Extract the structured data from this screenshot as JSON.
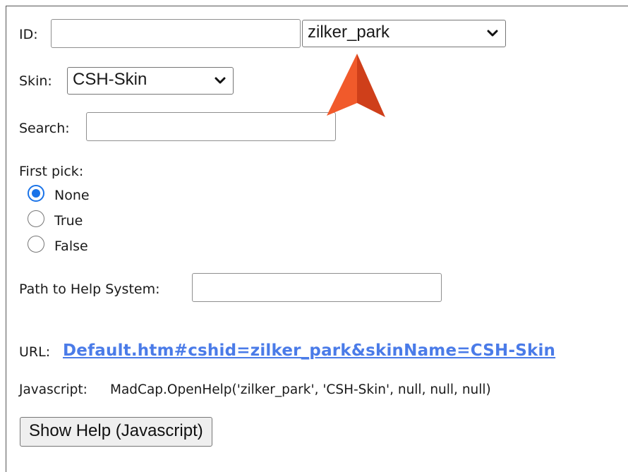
{
  "form": {
    "id_label": "ID:",
    "id_value": "",
    "id_select_value": "zilker_park",
    "skin_label": "Skin:",
    "skin_select_value": "CSH-Skin",
    "search_label": "Search:",
    "search_value": "",
    "first_pick_label": "First pick:",
    "radio_options": [
      {
        "label": "None",
        "checked": true
      },
      {
        "label": "True",
        "checked": false
      },
      {
        "label": "False",
        "checked": false
      }
    ],
    "path_label": "Path to Help System:",
    "path_value": ""
  },
  "output": {
    "url_label": "URL:",
    "url_link": "Default.htm#cshid=zilker_park&skinName=CSH-Skin",
    "javascript_label": "Javascript:",
    "javascript_code": "MadCap.OpenHelp('zilker_park', 'CSH-Skin', null, null, null)",
    "show_help_button": "Show Help (Javascript)"
  },
  "annotation": {
    "arrow_icon": "pointer-arrow-icon",
    "arrow_color": "#e8542a"
  },
  "colors": {
    "link": "#4a7be8",
    "radio_checked": "#1a73e8"
  }
}
